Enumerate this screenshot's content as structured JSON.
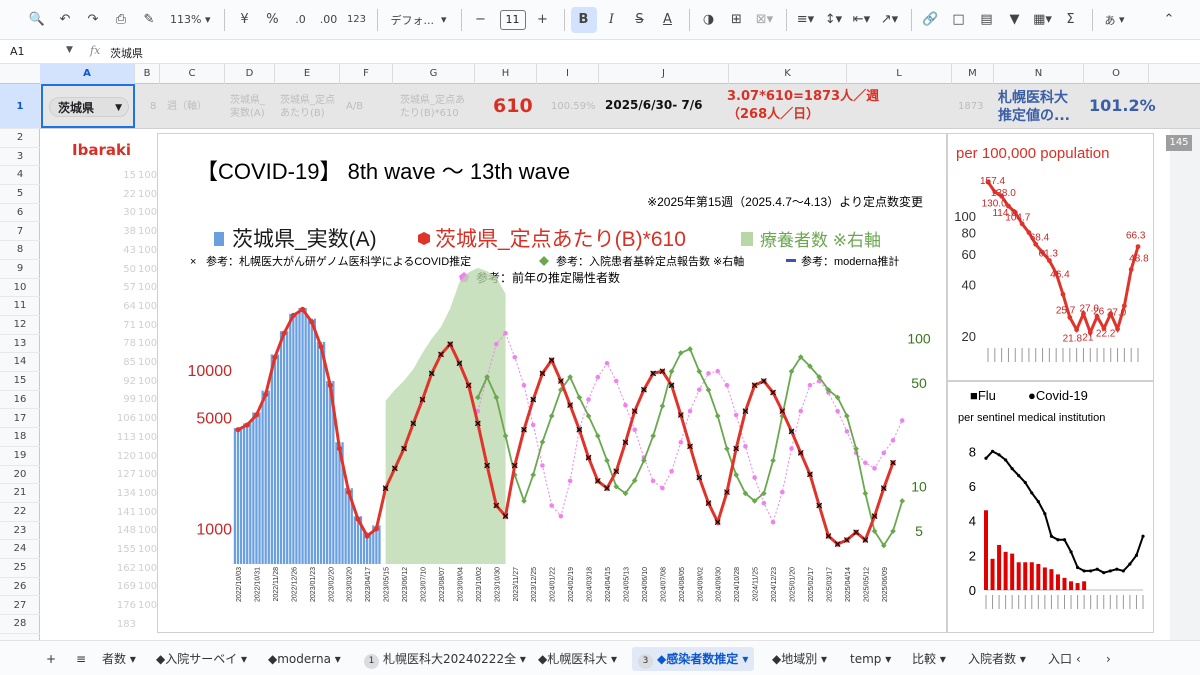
{
  "toolbar": {
    "zoom": "113%",
    "currency": "¥",
    "percent": "%",
    "dec_decrease": ".0",
    "dec_increase": ".00",
    "format_123": "123",
    "font": "デフォ...",
    "font_size": "11",
    "bold": "B",
    "italic": "I",
    "strike": "S",
    "textcolor": "A",
    "sum": "Σ",
    "input_mode": "あ"
  },
  "formula": {
    "namebox": "A1",
    "value": "茨城県"
  },
  "columns": [
    "A",
    "B",
    "C",
    "D",
    "E",
    "F",
    "G",
    "H",
    "I",
    "J",
    "K",
    "L",
    "M",
    "N",
    "O"
  ],
  "rows": [
    "1",
    "2",
    "3",
    "4",
    "5",
    "6",
    "7",
    "8",
    "9",
    "10",
    "11",
    "12",
    "13",
    "14",
    "15",
    "16",
    "17",
    "18",
    "19",
    "20",
    "21",
    "22",
    "23",
    "24",
    "25",
    "26",
    "27",
    "28"
  ],
  "row1": {
    "a1": "茨城県",
    "b1": "8",
    "c1": "週（軸）",
    "d1_line1": "茨城県_",
    "d1_line2": "実数(A)",
    "e1_line1": "茨城県_定点",
    "e1_line2": "あたり(B)",
    "f1": "A/B",
    "g1_line1": "茨城県_定点あ",
    "g1_line2": "たり(B)*610",
    "h1": "610",
    "i1": "100.59%",
    "j1": "2025/6/30- 7/6",
    "k1_line1": "3.07*610=1873人／週",
    "k1_line2": "（268人／日）",
    "m1": "1873",
    "n1_line1": "札幌医科大",
    "n1_line2": "推定値の...",
    "o1": "101.2%"
  },
  "grid": {
    "ibaraki": "Ibaraki",
    "colB_values": [
      "15",
      "22",
      "30",
      "38",
      "43",
      "50",
      "57",
      "64",
      "71",
      "78",
      "85",
      "92",
      "99",
      "106",
      "113",
      "120",
      "127",
      "134",
      "141",
      "148",
      "155",
      "162",
      "169",
      "176",
      "183"
    ],
    "colC_values": [
      "100",
      "100",
      "100",
      "100",
      "100",
      "100",
      "100",
      "100",
      "100",
      "100",
      "100",
      "100",
      "100",
      "100",
      "100",
      "100",
      "100",
      "100",
      "100",
      "100",
      "100",
      "100",
      "100",
      "100"
    ],
    "scroll_value": "145"
  },
  "main_chart": {
    "title": "【COVID-19】 8th wave 〜 13th wave",
    "note": "※2025年第15週（2025.4.7〜4.13）より定点数変更",
    "legend": {
      "actual": "茨城県_実数(A)",
      "sentinel": "茨城県_定点あたり(B)*610",
      "recuperating": "療養者数 ※右軸",
      "sapporo": "参考：札幌医大がん研ゲノム医科学によるCOVID推定",
      "hospital": "参考：入院患者基幹定点報告数 ※右軸",
      "moderna": "参考：moderna推計",
      "prev_year": "参考：前年の推定陽性者数"
    },
    "colors": {
      "actual": "#6a9fe0",
      "sentinel": "#e0342b",
      "recuperating": "#b7d7a8",
      "sapporo": "#000000",
      "hospital": "#6aa84f",
      "moderna": "#3f51b5",
      "prev_year": "#ee82ee"
    }
  },
  "chart_data": [
    {
      "type": "line",
      "title": "【COVID-19】 8th wave 〜 13th wave",
      "y_axis_left": {
        "scale": "log",
        "ticks": [
          1000,
          5000,
          10000
        ],
        "range": [
          600,
          30000
        ]
      },
      "y_axis_right": {
        "scale": "log",
        "ticks": [
          5,
          10,
          50,
          100
        ],
        "range": [
          3,
          200
        ]
      },
      "x": [
        "2022/10/03",
        "2022/10/17",
        "2022/10/31",
        "2022/11/14",
        "2022/11/28",
        "2022/12/12",
        "2022/12/26",
        "2023/01/09",
        "2023/01/23",
        "2023/02/06",
        "2023/02/20",
        "2023/03/06",
        "2023/03/20",
        "2023/04/03",
        "2023/04/17",
        "2023/05/01",
        "2023/05/15",
        "2023/05/29",
        "2023/06/12",
        "2023/06/26",
        "2023/07/10",
        "2023/07/24",
        "2023/08/07",
        "2023/08/21",
        "2023/09/04",
        "2023/09/18",
        "2023/10/02",
        "2023/10/16",
        "2023/10/30",
        "2023/11/13",
        "2023/11/27",
        "2023/12/11",
        "2023/12/25",
        "2024/01/08",
        "2024/01/22",
        "2024/02/05",
        "2024/02/19",
        "2024/03/04",
        "2024/03/18",
        "2024/04/01",
        "2024/04/15",
        "2024/04/29",
        "2024/05/13",
        "2024/05/27",
        "2024/06/10",
        "2024/06/24",
        "2024/07/08",
        "2024/07/22",
        "2024/08/05",
        "2024/08/19",
        "2024/09/02",
        "2024/09/16",
        "2024/09/30",
        "2024/10/14",
        "2024/10/28",
        "2024/11/11",
        "2024/11/25",
        "2024/12/09",
        "2024/12/23",
        "2025/01/06",
        "2025/01/20",
        "2025/02/03",
        "2025/02/17",
        "2025/03/03",
        "2025/03/17",
        "2025/03/31",
        "2025/04/14",
        "2025/04/28",
        "2025/05/12",
        "2025/05/26",
        "2025/06/09",
        "2025/06/23"
      ],
      "series": [
        {
          "name": "茨城県_実数(A)",
          "start_index": 0,
          "values": [
            4300,
            4600,
            5400,
            7400,
            12500,
            17500,
            22500,
            24500,
            21000,
            15000,
            8500,
            3500,
            1800,
            1200,
            950,
            1050
          ]
        },
        {
          "name": "茨城県_定点あたり(B)*610",
          "start_index": 0,
          "values": [
            4200,
            4500,
            5200,
            7000,
            12000,
            17000,
            22000,
            24000,
            20000,
            14000,
            8000,
            3200,
            1700,
            1150,
            900,
            1000,
            1800,
            2400,
            3200,
            4600,
            6500,
            9500,
            12500,
            14500,
            11000,
            8000,
            4600,
            2500,
            1400,
            1200,
            2500,
            4200,
            6500,
            9500,
            11500,
            8500,
            6000,
            4200,
            2800,
            2000,
            1800,
            2300,
            3500,
            5500,
            7500,
            9500,
            9800,
            8000,
            5200,
            3300,
            2100,
            1450,
            1100,
            1700,
            3200,
            5500,
            8000,
            8500,
            7200,
            5500,
            4100,
            3000,
            2200,
            1400,
            900,
            800,
            850,
            950,
            850,
            1200,
            1800,
            2600
          ]
        },
        {
          "name": "療養者数 ※右軸",
          "start_index": 16,
          "values": [
            38,
            45,
            52,
            62,
            80,
            100,
            120,
            160,
            240,
            280,
            300,
            285,
            260,
            200
          ]
        },
        {
          "name": "参考：入院患者基幹定点報告数 ※右軸",
          "start_index": 26,
          "values": [
            40,
            55,
            40,
            22,
            12,
            8,
            12,
            20,
            30,
            45,
            55,
            40,
            30,
            22,
            15,
            10,
            9,
            11,
            15,
            22,
            35,
            60,
            80,
            85,
            60,
            45,
            30,
            18,
            12,
            9,
            8,
            9,
            15,
            30,
            60,
            75,
            65,
            55,
            45,
            40,
            30,
            18,
            9,
            5,
            4,
            5,
            8
          ]
        },
        {
          "name": "参考：前年の推定陽性者数",
          "start_index": 26,
          "values": [
            5500,
            9000,
            14500,
            17000,
            12000,
            8000,
            4500,
            2500,
            1400,
            1200,
            2000,
            4200,
            6500,
            9000,
            11000,
            8500,
            6000,
            4200,
            2800,
            2000,
            1800,
            2300,
            3500,
            5500,
            7500,
            9500,
            9800,
            8000,
            5200,
            3300,
            2100,
            1450,
            1100,
            1700,
            3200,
            5500,
            8000,
            8500,
            7200,
            5500,
            4100,
            3000,
            2600,
            2400,
            3000,
            3600,
            4800
          ]
        }
      ]
    },
    {
      "type": "line",
      "title": "per 100,000 population",
      "y_axis": {
        "scale": "log",
        "ticks": [
          20,
          40,
          60,
          80,
          100
        ],
        "range": [
          18,
          180
        ]
      },
      "series": [
        {
          "name": "per 100,000 population",
          "values": [
            157.4,
            138.0,
            130.0,
            114.0,
            104.7,
            90.0,
            80.0,
            68.4,
            61.3,
            55.0,
            46.4,
            35.0,
            25.7,
            21.8,
            27.0,
            21.0,
            26.0,
            22.2,
            27.0,
            22.0,
            30.0,
            48.8,
            66.3
          ]
        }
      ],
      "labels": [
        "157.4",
        "138.0",
        "130.0",
        "114.0",
        "104.7",
        "68.4",
        "61.3",
        "46.4",
        "25.7",
        "21.8",
        "27.0",
        "21",
        "26",
        "22.2",
        "27.0",
        "48.8",
        "66.3"
      ]
    },
    {
      "type": "bar",
      "title": "per sentinel medical institution",
      "legend": [
        "■Flu",
        "●Covid-19"
      ],
      "y_axis": {
        "ticks": [
          0,
          2,
          4,
          6,
          8
        ],
        "range": [
          0,
          9
        ]
      },
      "series": [
        {
          "name": "Flu",
          "type": "bar",
          "values": [
            4.6,
            1.8,
            2.6,
            2.2,
            2.1,
            1.6,
            1.6,
            1.6,
            1.5,
            1.3,
            1.2,
            0.9,
            0.7,
            0.5,
            0.4,
            0.5
          ]
        },
        {
          "name": "Covid-19",
          "type": "line",
          "values": [
            7.6,
            8.0,
            7.8,
            7.5,
            7.0,
            6.6,
            6.2,
            5.6,
            5.1,
            4.4,
            3.1,
            2.9,
            2.9,
            2.2,
            1.3,
            1.1,
            1.1,
            1.2,
            1.0,
            1.1,
            1.2,
            1.1,
            1.5,
            2.0,
            3.1
          ]
        }
      ]
    }
  ],
  "tabs": [
    {
      "label": "+"
    },
    {
      "label": "≡"
    },
    {
      "label": "者数 ▾"
    },
    {
      "label": "◆入院サーベイ ▾"
    },
    {
      "label": "◆moderna ▾"
    },
    {
      "label": "札幌医科大20240222全 ▾",
      "badge": "1"
    },
    {
      "label": "◆札幌医科大 ▾"
    },
    {
      "label": "◆感染者数推定 ▾",
      "badge": "3",
      "active": true
    },
    {
      "label": "◆地域別 ▾"
    },
    {
      "label": "temp ▾"
    },
    {
      "label": "比較 ▾"
    },
    {
      "label": "入院者数 ▾"
    },
    {
      "label": "入口"
    },
    {
      "label": "‹"
    },
    {
      "label": "›"
    }
  ]
}
